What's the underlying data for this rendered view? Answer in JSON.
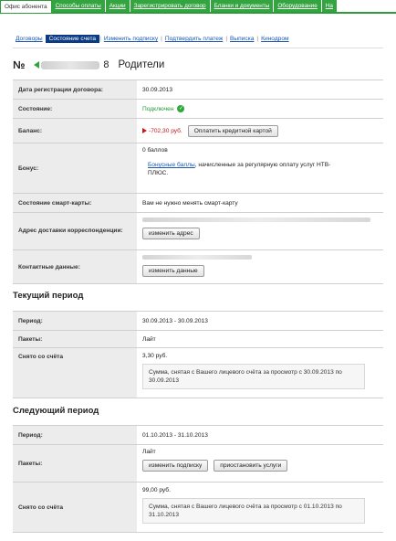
{
  "topnav": [
    "Офис абонента",
    "Способы оплаты",
    "Акции",
    "Зарегистрировать договор",
    "Бланки и документы",
    "Оборудование",
    "На"
  ],
  "subnav": [
    "Договоры",
    "Состояние счета",
    "Изменить подписку",
    "Подтвердить платеж",
    "Выписка",
    "Кинодром"
  ],
  "heading": {
    "prefix": "№",
    "num": "8",
    "name": "Родители"
  },
  "account": {
    "reg_label": "Дата регистрации договора:",
    "reg_value": "30.09.2013",
    "state_label": "Состояние:",
    "state_value": "Подключен",
    "balance_label": "Баланс:",
    "balance_value": "-702,30 руб.",
    "pay_button": "Оплатить кредитной картой",
    "bonus_label": "Бонус:",
    "bonus_points": "0 баллов",
    "bonus_link": "Бонусные баллы",
    "bonus_text": ", начисленные за регулярную оплату услуг НТВ-ПЛЮС.",
    "smartcard_label": "Состояние смарт-карты:",
    "smartcard_value": "Вам не нужно менять смарт-карту",
    "address_label": "Адрес доставки корреспонденции:",
    "address_button": "изменить адрес",
    "contacts_label": "Контактные данные:",
    "contacts_button": "изменить данные"
  },
  "current": {
    "title": "Текущий период",
    "period_label": "Период:",
    "period_value": "30.09.2013 - 30.09.2013",
    "packages_label": "Пакеты:",
    "packages_value": "Лайт",
    "charged_label": "Снято со счёта",
    "charged_value": "3,30 руб.",
    "charged_note": "Сумма, снятая с Вашего лицевого счёта за просмотр с 30.09.2013 по 30.09.2013"
  },
  "next": {
    "title": "Следующий период",
    "period_label": "Период:",
    "period_value": "01.10.2013 - 31.10.2013",
    "packages_label": "Пакеты:",
    "packages_value": "Лайт",
    "change_button": "изменить подписку",
    "suspend_button": "приостановить услуги",
    "charged_label": "Снято со счёта",
    "charged_value": "99,00 руб.",
    "charged_note": "Сумма, снятая с Вашего лицевого счёта за просмотр с 01.10.2013 по 31.10.2013"
  }
}
